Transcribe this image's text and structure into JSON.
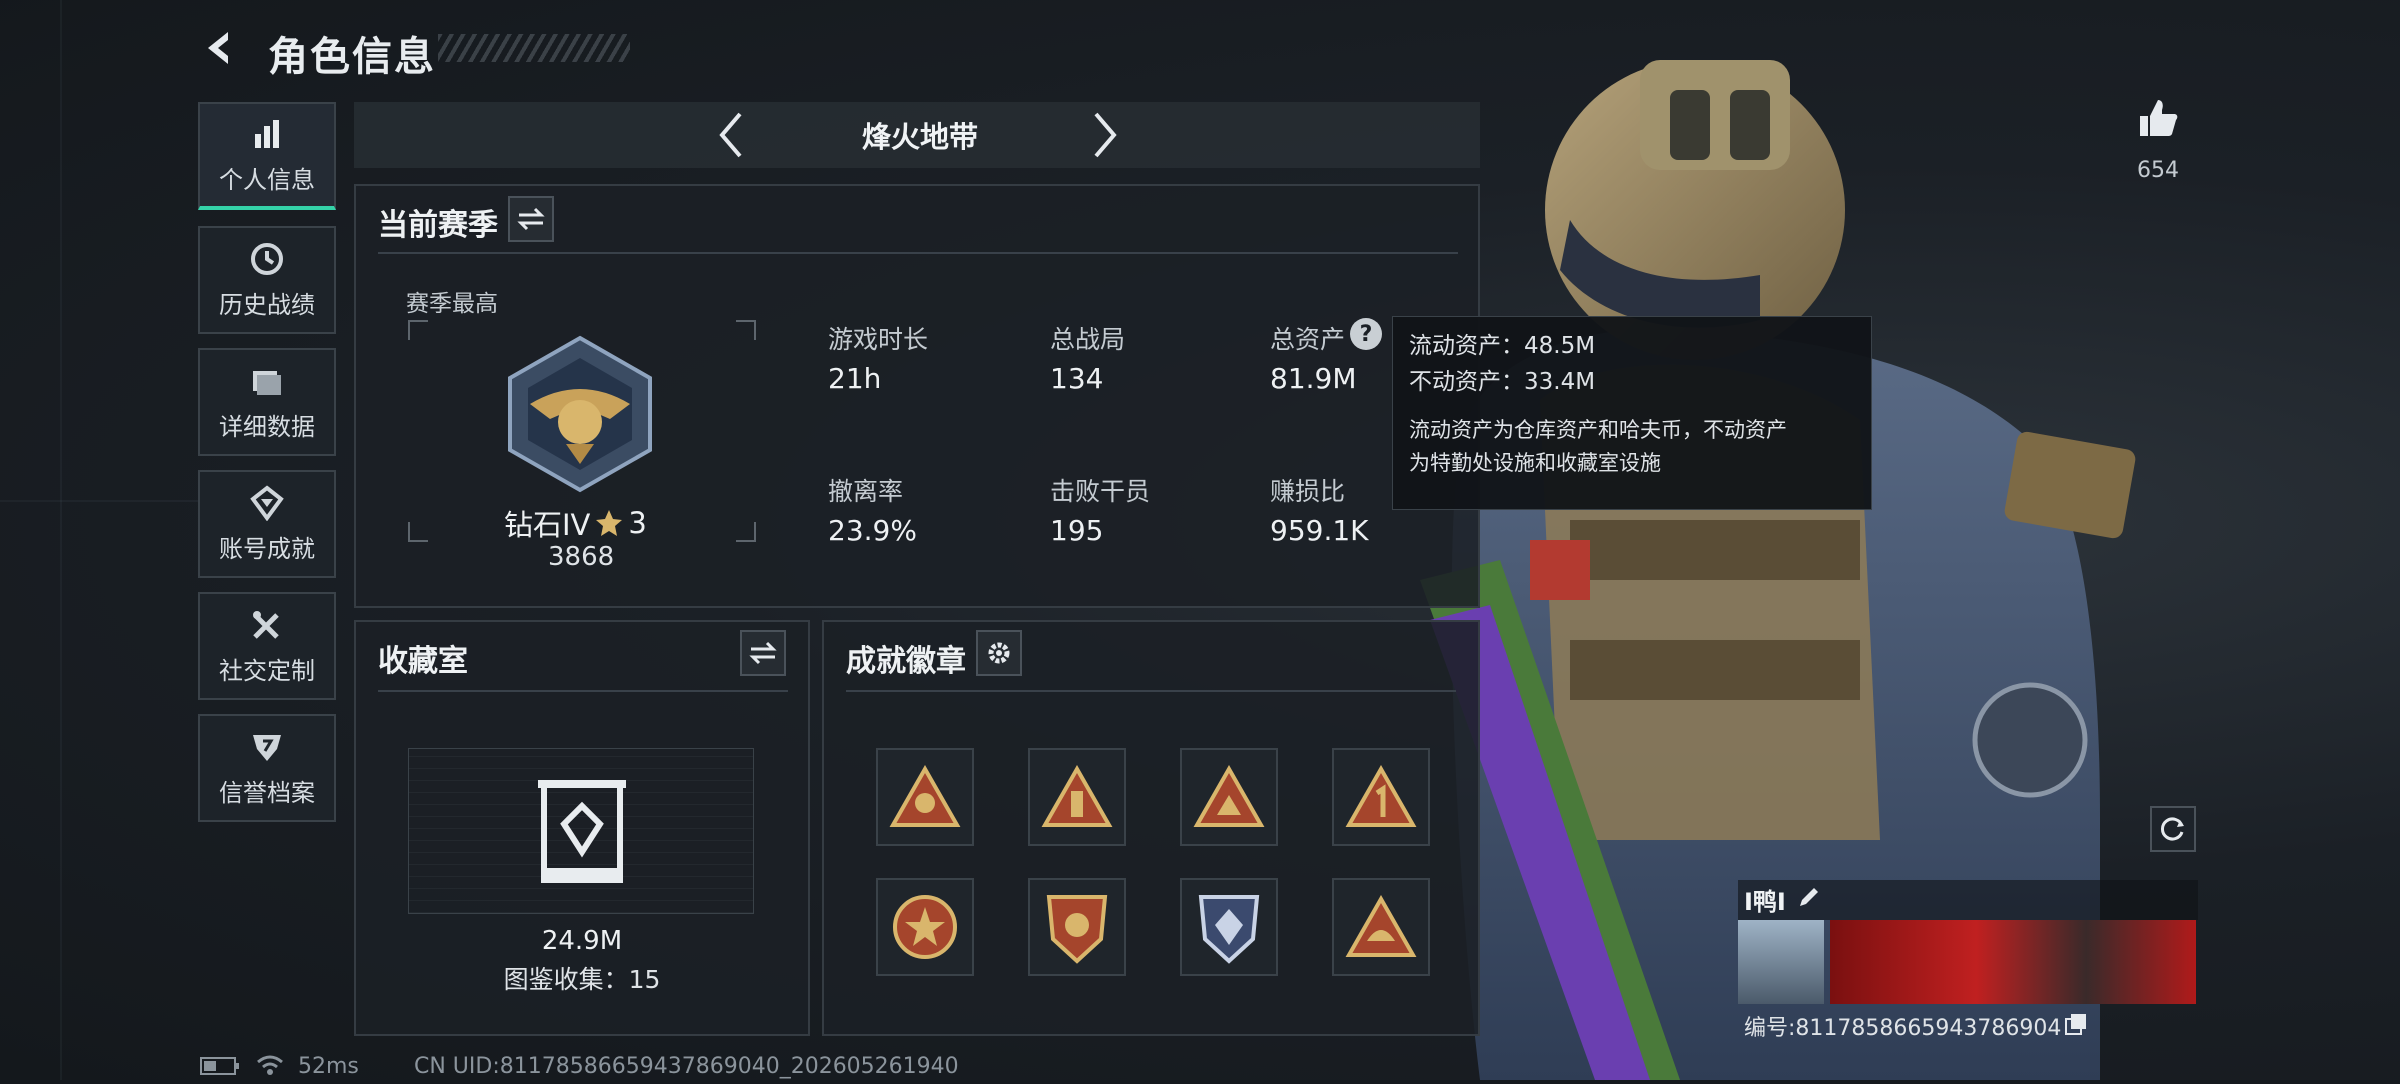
{
  "header": {
    "title": "角色信息"
  },
  "sidebar": {
    "items": [
      {
        "label": "个人信息",
        "icon": "bar-chart-icon",
        "active": true
      },
      {
        "label": "历史战绩",
        "icon": "clock-icon"
      },
      {
        "label": "详细数据",
        "icon": "folder-icon"
      },
      {
        "label": "账号成就",
        "icon": "achievement-icon"
      },
      {
        "label": "社交定制",
        "icon": "tools-icon"
      },
      {
        "label": "信誉档案",
        "icon": "shield-icon"
      }
    ]
  },
  "mode": {
    "label": "烽火地带"
  },
  "season": {
    "title": "当前赛季",
    "best_label": "赛季最高",
    "rank_name": "钻石IV",
    "rank_stars": "3",
    "rank_score": "3868",
    "stats": [
      {
        "label": "游戏时长",
        "value": "21h"
      },
      {
        "label": "总战局",
        "value": "134"
      },
      {
        "label": "总资产",
        "value": "81.9M"
      },
      {
        "label": "撤离率",
        "value": "23.9%"
      },
      {
        "label": "击败干员",
        "value": "195"
      },
      {
        "label": "赚损比",
        "value": "959.1K"
      }
    ]
  },
  "tooltip": {
    "liquid": "流动资产：48.5M",
    "fixed": "不动资产：33.4M",
    "desc_line1": "流动资产为仓库资产和哈夫币，不动资产",
    "desc_line2": "为特勤处设施和收藏室设施"
  },
  "collection": {
    "title": "收藏室",
    "value": "24.9M",
    "catalog": "图鉴收集：15"
  },
  "badges": {
    "title": "成就徽章"
  },
  "likes": {
    "count": "654"
  },
  "profile": {
    "name": "I鸭I",
    "id": "编号:8117858665943786904"
  },
  "status": {
    "ping": "52ms",
    "uid": "CN UID:81178586659437869040_202605261940"
  },
  "colors": {
    "accent": "#34d3a8",
    "bg": "#15191d",
    "panel": "#1b2026"
  }
}
